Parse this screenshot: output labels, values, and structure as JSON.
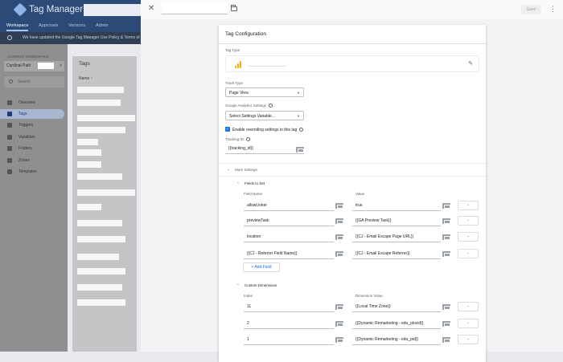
{
  "app": {
    "title": "Tag Manager 360"
  },
  "nav": {
    "tabs": [
      "Workspace",
      "Approvals",
      "Versions",
      "Admin"
    ]
  },
  "notice": "We have updated the Google Tag Manager Use Policy & Terms of Ser",
  "sidebar": {
    "current_workspace_label": "CURRENT WORKSPACE",
    "workspace_name": "Cardinal Path",
    "search_placeholder": "Search",
    "items": [
      {
        "label": "Overview",
        "icon": "overview-icon"
      },
      {
        "label": "Tags",
        "icon": "tag-icon",
        "active": true
      },
      {
        "label": "Triggers",
        "icon": "trigger-icon"
      },
      {
        "label": "Variables",
        "icon": "variable-icon"
      },
      {
        "label": "Folders",
        "icon": "folder-icon"
      },
      {
        "label": "Zones",
        "icon": "zone-icon"
      },
      {
        "label": "Templates",
        "icon": "template-icon"
      }
    ]
  },
  "tags_list": {
    "title": "Tags",
    "name_header": "Name ↑"
  },
  "panel": {
    "save_label": "Save",
    "close_icon": "close-icon",
    "more_icon": "more-vert-icon"
  },
  "config": {
    "title": "Tag Configuration",
    "tag_type_label": "Tag Type",
    "track_type_label": "Track Type",
    "track_type_value": "Page View",
    "ga_settings_label": "Google Analytics Settings",
    "ga_settings_value": "Select Settings Variable...",
    "override_label": "Enable overriding settings in this tag",
    "tracking_id_label": "Tracking ID",
    "tracking_id_value": "{{tracking_id}}",
    "more_settings_label": "More Settings",
    "fields_to_set": {
      "label": "Fields to Set",
      "col_name": "Field Name",
      "col_value": "Value",
      "rows": [
        {
          "name": "allowLinker",
          "value": "true"
        },
        {
          "name": "previewTask",
          "value": "{{GA Preview Task}}"
        },
        {
          "name": "location",
          "value": "{{CJ - Email Escape Page URL}}"
        },
        {
          "name": "{{CJ - Referrer Field Name}}",
          "value": "{{CJ - Email Escape Referrer}}"
        }
      ],
      "add_label": "+ Add Field"
    },
    "custom_dimensions": {
      "label": "Custom Dimensions",
      "col_index": "Index",
      "col_value": "Dimension Value",
      "rows": [
        {
          "index": "11",
          "value": "{{Local Time Zone}}"
        },
        {
          "index": "2",
          "value": "{{Dynamic Remarketing - edu_plocid}}"
        },
        {
          "index": "1",
          "value": "{{Dynamic Remarketing - edu_pid}}"
        }
      ]
    }
  },
  "colors": {
    "accent": "#1a73e8",
    "header_bg": "#2b4a78",
    "ga_orange": "#f9ab00"
  }
}
